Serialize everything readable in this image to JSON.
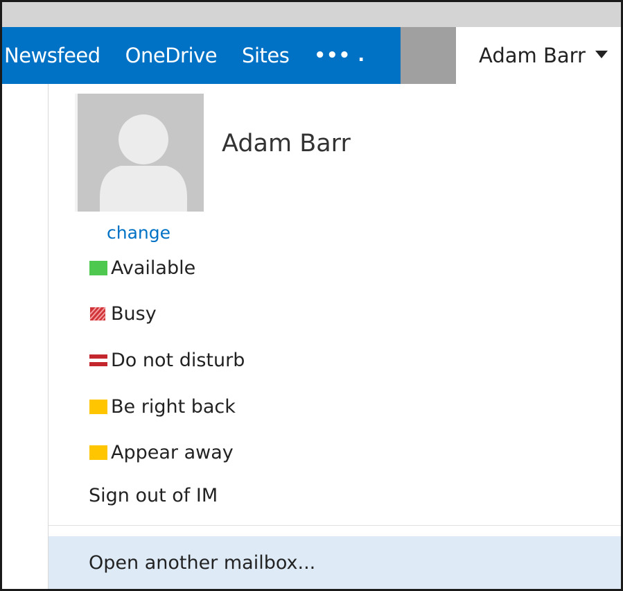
{
  "nav": {
    "items": [
      {
        "label": "Newsfeed"
      },
      {
        "label": "OneDrive"
      },
      {
        "label": "Sites"
      }
    ],
    "more_label": "••• .",
    "user_name": "Adam Barr"
  },
  "profile": {
    "display_name": "Adam Barr",
    "change_label": "change"
  },
  "statuses": [
    {
      "label": "Available",
      "icon": "available-icon",
      "color": "#4fc84f"
    },
    {
      "label": "Busy",
      "icon": "busy-icon",
      "color": "#d13438"
    },
    {
      "label": "Do not disturb",
      "icon": "do-not-disturb-icon",
      "color": "#c4262e"
    },
    {
      "label": "Be right back",
      "icon": "be-right-back-icon",
      "color": "#ffc600"
    },
    {
      "label": "Appear away",
      "icon": "appear-away-icon",
      "color": "#ffc600"
    }
  ],
  "menu": {
    "sign_out_label": "Sign out of IM",
    "open_mailbox_label": "Open another mailbox..."
  },
  "colors": {
    "brand_blue": "#0072c6",
    "highlight": "#deebf7"
  }
}
